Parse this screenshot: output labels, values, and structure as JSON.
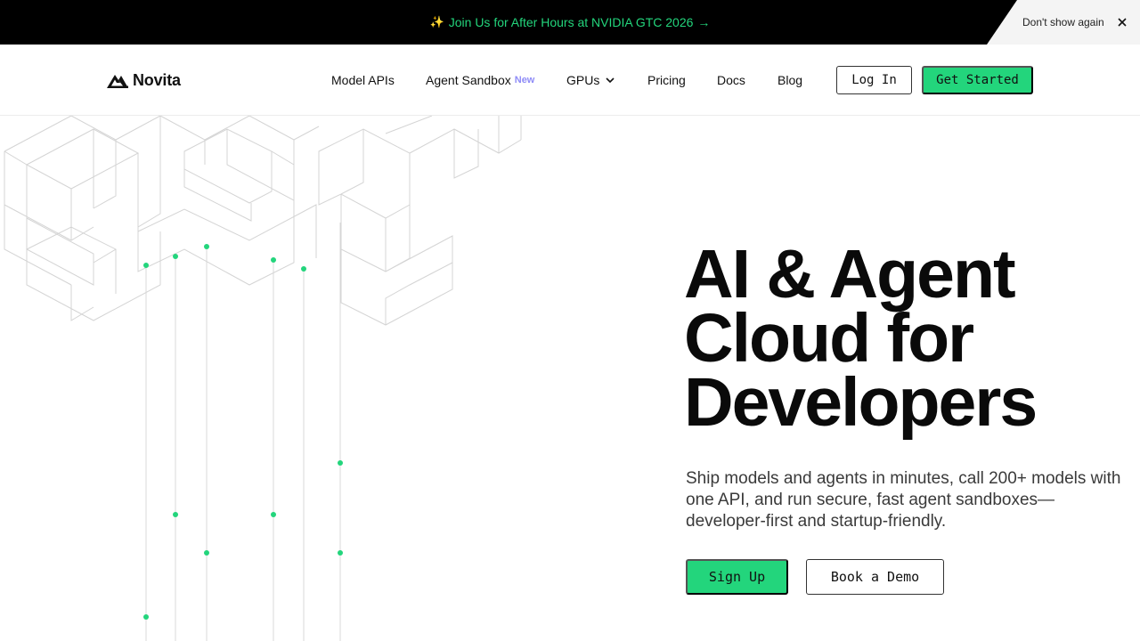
{
  "announcement": {
    "sparkle": "✨",
    "text": "Join Us for After Hours at NVIDIA GTC 2026",
    "arrow": "→",
    "dismiss_label": "Don't show again",
    "close_icon": "close-icon"
  },
  "nav": {
    "brand": "Novita",
    "logo_icon": "novita-logo-icon",
    "items": [
      {
        "label": "Model APIs"
      },
      {
        "label": "Agent Sandbox",
        "badge": "New"
      },
      {
        "label": "GPUs",
        "icon": "chevron-down-icon"
      },
      {
        "label": "Pricing"
      },
      {
        "label": "Docs"
      },
      {
        "label": "Blog"
      }
    ],
    "login_label": "Log In",
    "get_started_label": "Get Started"
  },
  "hero": {
    "title_lines": [
      "AI & Agent",
      "Cloud for",
      "Developers"
    ],
    "subtitle_lines": [
      "Ship models and agents in minutes, call 200+ models with",
      "one API, and run secure, fast agent sandboxes—",
      "developer-first and startup-friendly."
    ],
    "primary_cta": "Sign Up",
    "secondary_cta": "Book a Demo"
  },
  "colors": {
    "accent": "#23d57c",
    "badge": "#8f8cf7",
    "announcement_bg": "#000000",
    "text": "#111111"
  }
}
